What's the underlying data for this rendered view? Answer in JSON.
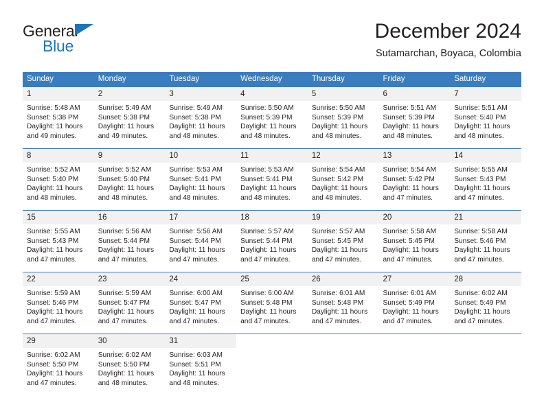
{
  "logo": {
    "name_top": "General",
    "name_bottom": "Blue",
    "triangle_icon": "triangle-icon",
    "color_blue": "#1b75bb",
    "color_dark": "#231f20"
  },
  "header": {
    "title": "December 2024",
    "subtitle": "Sutamarchan, Boyaca, Colombia"
  },
  "theme": {
    "header_band": "#3a7cbe",
    "daynum_bg": "#f1f1f1",
    "row_divider": "#3a7cbe",
    "text": "#231f20"
  },
  "calendar": {
    "weekday_headers": [
      "Sunday",
      "Monday",
      "Tuesday",
      "Wednesday",
      "Thursday",
      "Friday",
      "Saturday"
    ],
    "weeks": [
      [
        {
          "day": "1",
          "sunrise": "Sunrise: 5:48 AM",
          "sunset": "Sunset: 5:38 PM",
          "daylight1": "Daylight: 11 hours",
          "daylight2": "and 49 minutes."
        },
        {
          "day": "2",
          "sunrise": "Sunrise: 5:49 AM",
          "sunset": "Sunset: 5:38 PM",
          "daylight1": "Daylight: 11 hours",
          "daylight2": "and 49 minutes."
        },
        {
          "day": "3",
          "sunrise": "Sunrise: 5:49 AM",
          "sunset": "Sunset: 5:38 PM",
          "daylight1": "Daylight: 11 hours",
          "daylight2": "and 48 minutes."
        },
        {
          "day": "4",
          "sunrise": "Sunrise: 5:50 AM",
          "sunset": "Sunset: 5:39 PM",
          "daylight1": "Daylight: 11 hours",
          "daylight2": "and 48 minutes."
        },
        {
          "day": "5",
          "sunrise": "Sunrise: 5:50 AM",
          "sunset": "Sunset: 5:39 PM",
          "daylight1": "Daylight: 11 hours",
          "daylight2": "and 48 minutes."
        },
        {
          "day": "6",
          "sunrise": "Sunrise: 5:51 AM",
          "sunset": "Sunset: 5:39 PM",
          "daylight1": "Daylight: 11 hours",
          "daylight2": "and 48 minutes."
        },
        {
          "day": "7",
          "sunrise": "Sunrise: 5:51 AM",
          "sunset": "Sunset: 5:40 PM",
          "daylight1": "Daylight: 11 hours",
          "daylight2": "and 48 minutes."
        }
      ],
      [
        {
          "day": "8",
          "sunrise": "Sunrise: 5:52 AM",
          "sunset": "Sunset: 5:40 PM",
          "daylight1": "Daylight: 11 hours",
          "daylight2": "and 48 minutes."
        },
        {
          "day": "9",
          "sunrise": "Sunrise: 5:52 AM",
          "sunset": "Sunset: 5:40 PM",
          "daylight1": "Daylight: 11 hours",
          "daylight2": "and 48 minutes."
        },
        {
          "day": "10",
          "sunrise": "Sunrise: 5:53 AM",
          "sunset": "Sunset: 5:41 PM",
          "daylight1": "Daylight: 11 hours",
          "daylight2": "and 48 minutes."
        },
        {
          "day": "11",
          "sunrise": "Sunrise: 5:53 AM",
          "sunset": "Sunset: 5:41 PM",
          "daylight1": "Daylight: 11 hours",
          "daylight2": "and 48 minutes."
        },
        {
          "day": "12",
          "sunrise": "Sunrise: 5:54 AM",
          "sunset": "Sunset: 5:42 PM",
          "daylight1": "Daylight: 11 hours",
          "daylight2": "and 48 minutes."
        },
        {
          "day": "13",
          "sunrise": "Sunrise: 5:54 AM",
          "sunset": "Sunset: 5:42 PM",
          "daylight1": "Daylight: 11 hours",
          "daylight2": "and 47 minutes."
        },
        {
          "day": "14",
          "sunrise": "Sunrise: 5:55 AM",
          "sunset": "Sunset: 5:43 PM",
          "daylight1": "Daylight: 11 hours",
          "daylight2": "and 47 minutes."
        }
      ],
      [
        {
          "day": "15",
          "sunrise": "Sunrise: 5:55 AM",
          "sunset": "Sunset: 5:43 PM",
          "daylight1": "Daylight: 11 hours",
          "daylight2": "and 47 minutes."
        },
        {
          "day": "16",
          "sunrise": "Sunrise: 5:56 AM",
          "sunset": "Sunset: 5:44 PM",
          "daylight1": "Daylight: 11 hours",
          "daylight2": "and 47 minutes."
        },
        {
          "day": "17",
          "sunrise": "Sunrise: 5:56 AM",
          "sunset": "Sunset: 5:44 PM",
          "daylight1": "Daylight: 11 hours",
          "daylight2": "and 47 minutes."
        },
        {
          "day": "18",
          "sunrise": "Sunrise: 5:57 AM",
          "sunset": "Sunset: 5:44 PM",
          "daylight1": "Daylight: 11 hours",
          "daylight2": "and 47 minutes."
        },
        {
          "day": "19",
          "sunrise": "Sunrise: 5:57 AM",
          "sunset": "Sunset: 5:45 PM",
          "daylight1": "Daylight: 11 hours",
          "daylight2": "and 47 minutes."
        },
        {
          "day": "20",
          "sunrise": "Sunrise: 5:58 AM",
          "sunset": "Sunset: 5:45 PM",
          "daylight1": "Daylight: 11 hours",
          "daylight2": "and 47 minutes."
        },
        {
          "day": "21",
          "sunrise": "Sunrise: 5:58 AM",
          "sunset": "Sunset: 5:46 PM",
          "daylight1": "Daylight: 11 hours",
          "daylight2": "and 47 minutes."
        }
      ],
      [
        {
          "day": "22",
          "sunrise": "Sunrise: 5:59 AM",
          "sunset": "Sunset: 5:46 PM",
          "daylight1": "Daylight: 11 hours",
          "daylight2": "and 47 minutes."
        },
        {
          "day": "23",
          "sunrise": "Sunrise: 5:59 AM",
          "sunset": "Sunset: 5:47 PM",
          "daylight1": "Daylight: 11 hours",
          "daylight2": "and 47 minutes."
        },
        {
          "day": "24",
          "sunrise": "Sunrise: 6:00 AM",
          "sunset": "Sunset: 5:47 PM",
          "daylight1": "Daylight: 11 hours",
          "daylight2": "and 47 minutes."
        },
        {
          "day": "25",
          "sunrise": "Sunrise: 6:00 AM",
          "sunset": "Sunset: 5:48 PM",
          "daylight1": "Daylight: 11 hours",
          "daylight2": "and 47 minutes."
        },
        {
          "day": "26",
          "sunrise": "Sunrise: 6:01 AM",
          "sunset": "Sunset: 5:48 PM",
          "daylight1": "Daylight: 11 hours",
          "daylight2": "and 47 minutes."
        },
        {
          "day": "27",
          "sunrise": "Sunrise: 6:01 AM",
          "sunset": "Sunset: 5:49 PM",
          "daylight1": "Daylight: 11 hours",
          "daylight2": "and 47 minutes."
        },
        {
          "day": "28",
          "sunrise": "Sunrise: 6:02 AM",
          "sunset": "Sunset: 5:49 PM",
          "daylight1": "Daylight: 11 hours",
          "daylight2": "and 47 minutes."
        }
      ],
      [
        {
          "day": "29",
          "sunrise": "Sunrise: 6:02 AM",
          "sunset": "Sunset: 5:50 PM",
          "daylight1": "Daylight: 11 hours",
          "daylight2": "and 47 minutes."
        },
        {
          "day": "30",
          "sunrise": "Sunrise: 6:02 AM",
          "sunset": "Sunset: 5:50 PM",
          "daylight1": "Daylight: 11 hours",
          "daylight2": "and 48 minutes."
        },
        {
          "day": "31",
          "sunrise": "Sunrise: 6:03 AM",
          "sunset": "Sunset: 5:51 PM",
          "daylight1": "Daylight: 11 hours",
          "daylight2": "and 48 minutes."
        },
        {
          "day": "",
          "sunrise": "",
          "sunset": "",
          "daylight1": "",
          "daylight2": ""
        },
        {
          "day": "",
          "sunrise": "",
          "sunset": "",
          "daylight1": "",
          "daylight2": ""
        },
        {
          "day": "",
          "sunrise": "",
          "sunset": "",
          "daylight1": "",
          "daylight2": ""
        },
        {
          "day": "",
          "sunrise": "",
          "sunset": "",
          "daylight1": "",
          "daylight2": ""
        }
      ]
    ]
  }
}
